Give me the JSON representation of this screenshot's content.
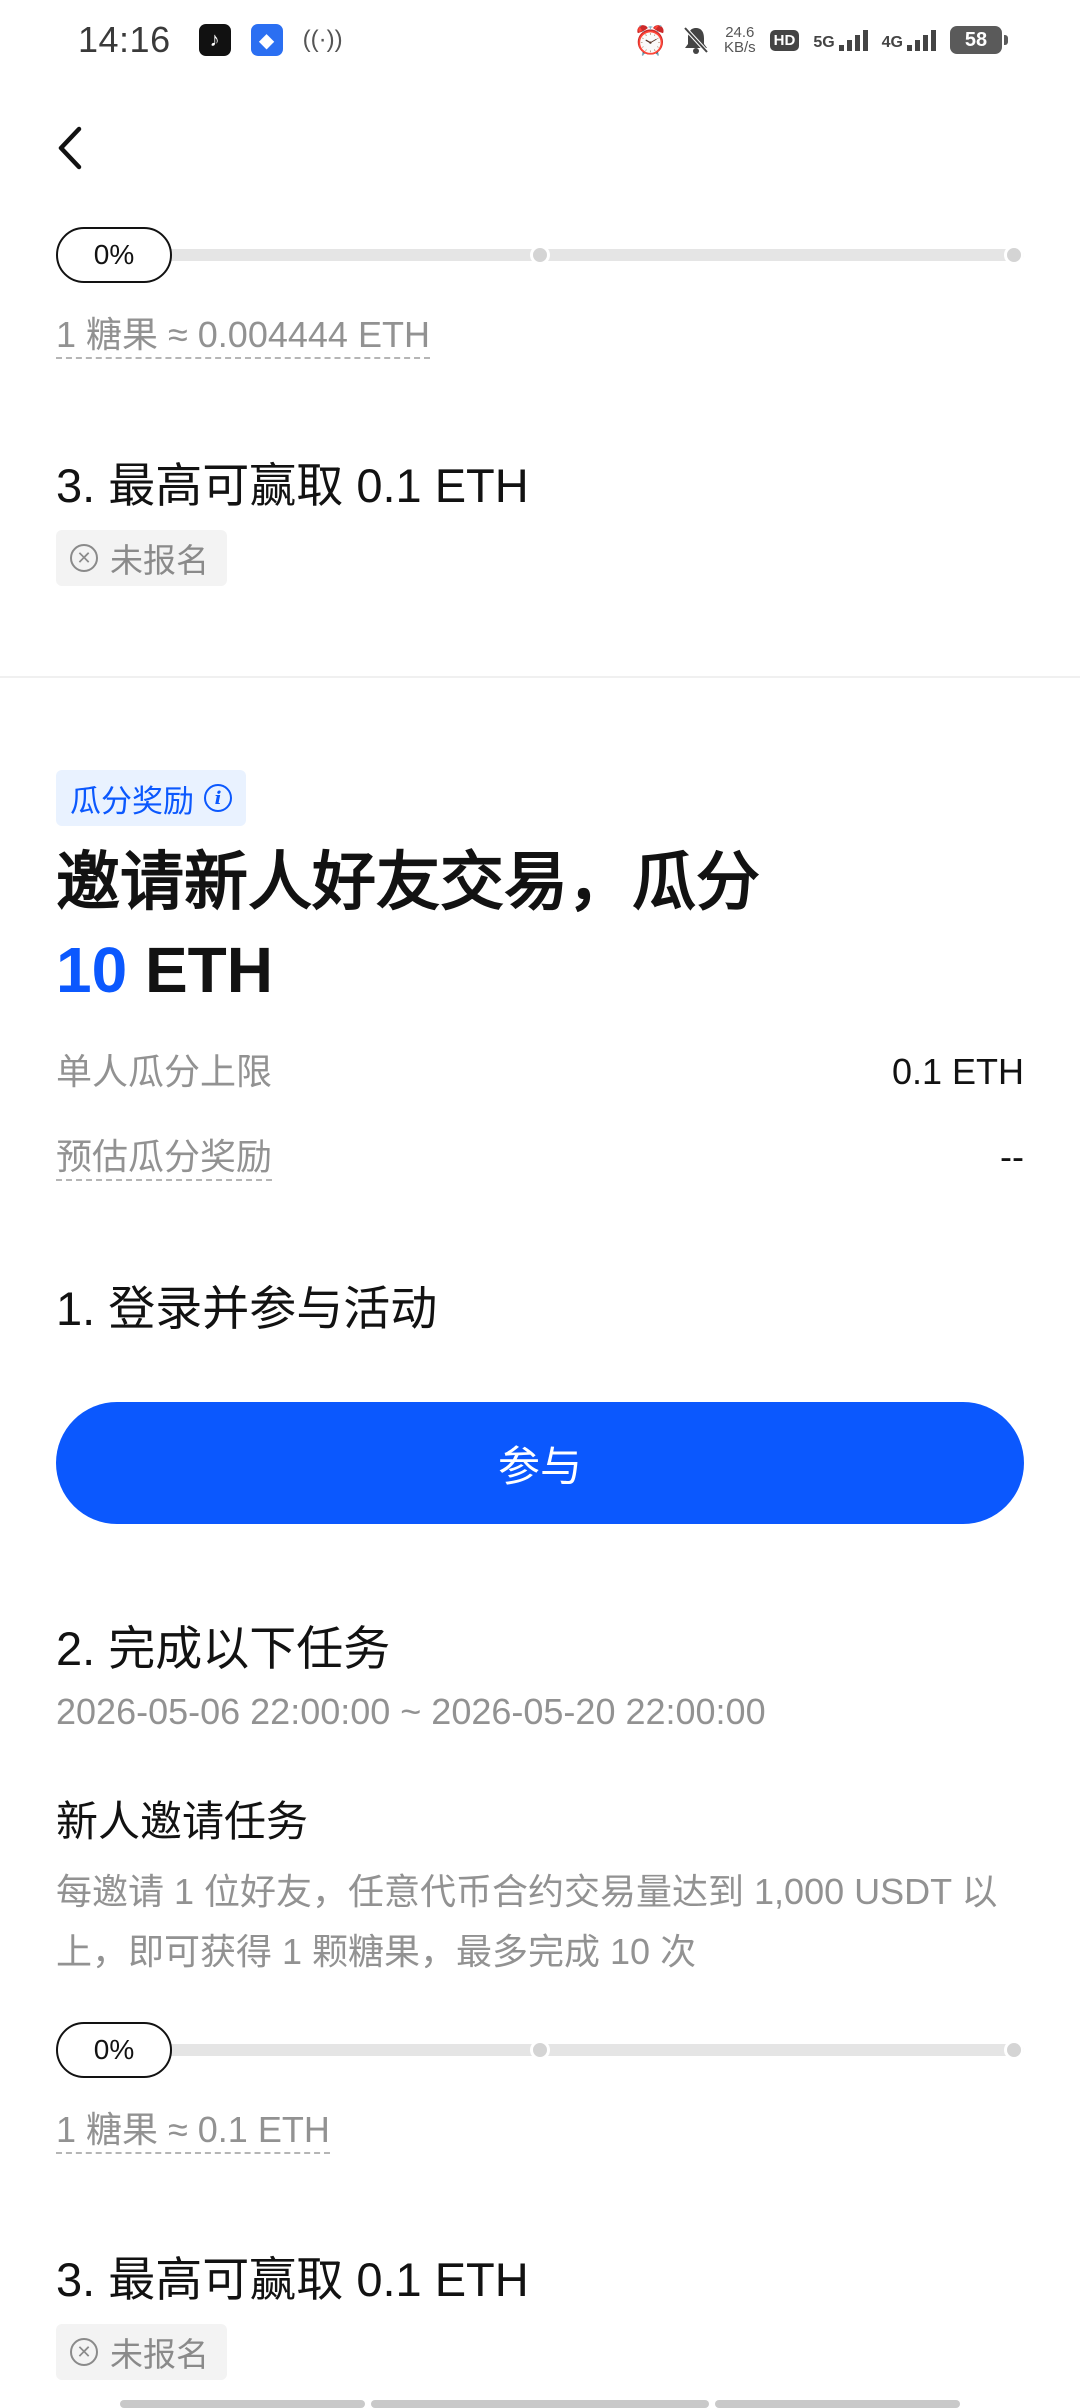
{
  "status_bar": {
    "time": "14:16",
    "notif_icons": [
      "tiktok-icon",
      "app-icon",
      "hotspot-icon"
    ],
    "net_speed_value": "24.6",
    "net_speed_unit": "KB/s",
    "hd_label": "HD",
    "sim1_label": "5G",
    "sim2_label": "4G",
    "battery": "58"
  },
  "section_top": {
    "progress_label": "0%",
    "progress_value": 0,
    "candy_rate": "1 糖果 ≈ 0.004444 ETH",
    "step3_title": "3. 最高可赢取 0.1 ETH",
    "signup_status": "未报名"
  },
  "section_split": {
    "tag_label": "瓜分奖励",
    "title_prefix": "邀请新人好友交易，瓜分 ",
    "title_amount": "10",
    "title_suffix": " ETH",
    "cap_label": "单人瓜分上限",
    "cap_value": "0.1 ETH",
    "estimate_label": "预估瓜分奖励",
    "estimate_value": "--",
    "step1_title": "1. 登录并参与活动",
    "join_button": "参与",
    "step2_title": "2. 完成以下任务",
    "date_range": "2026-05-06 22:00:00 ~ 2026-05-20 22:00:00",
    "task_title": "新人邀请任务",
    "task_desc": "每邀请 1 位好友，任意代币合约交易量达到 1,000 USDT 以上，即可获得 1 颗糖果，最多完成 10 次",
    "progress_label": "0%",
    "progress_value": 0,
    "candy_rate": "1 糖果 ≈ 0.1 ETH",
    "step3_title": "3. 最高可赢取 0.1 ETH",
    "signup_status": "未报名"
  },
  "colors": {
    "accent": "#0b58fe",
    "text_primary": "#121212",
    "text_secondary": "#929292",
    "tag_bg": "#e9f2ff",
    "status_bg": "#f3f3f3"
  }
}
